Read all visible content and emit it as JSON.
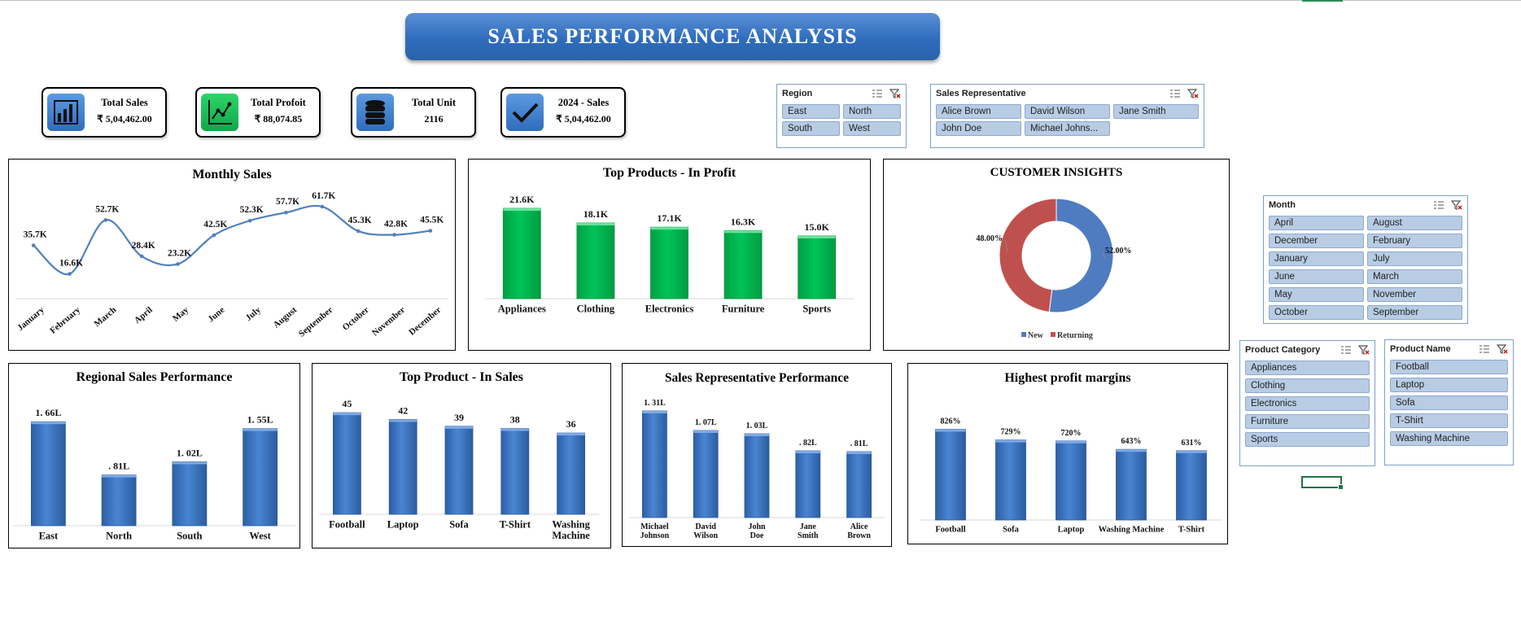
{
  "header": {
    "title": "SALES PERFORMANCE ANALYSIS"
  },
  "kpis": [
    {
      "label": "Total Sales",
      "value": "₹ 5,04,462.00",
      "icon": "bar-chart-icon",
      "color": "blue"
    },
    {
      "label": "Total Profoit",
      "value": "₹ 88,074.85",
      "icon": "line-chart-icon",
      "color": "green"
    },
    {
      "label": "Total Unit",
      "value": "2116",
      "icon": "database-icon",
      "color": "blue"
    },
    {
      "label": "2024 - Sales",
      "value": "₹ 5,04,462.00",
      "icon": "checkmark-icon",
      "color": "blue"
    }
  ],
  "colors": {
    "bar_blue": "#3a75c4",
    "bar_green": "#00b050",
    "donut_new": "#4f7cc0",
    "donut_returning": "#c0504d",
    "slicer_item": "#b8cce4"
  },
  "slicers": {
    "region": {
      "title": "Region",
      "items": [
        "East",
        "North",
        "South",
        "West"
      ]
    },
    "sales_rep": {
      "title": "Sales Representative",
      "items": [
        "Alice Brown",
        "David Wilson",
        "Jane Smith",
        "John Doe",
        "Michael Johns..."
      ]
    },
    "month": {
      "title": "Month",
      "items": [
        "April",
        "August",
        "December",
        "February",
        "January",
        "July",
        "June",
        "March",
        "May",
        "November",
        "October",
        "September"
      ]
    },
    "product_category": {
      "title": "Product Category",
      "items": [
        "Appliances",
        "Clothing",
        "Electronics",
        "Furniture",
        "Sports"
      ]
    },
    "product_name": {
      "title": "Product Name",
      "items": [
        "Football",
        "Laptop",
        "Sofa",
        "T-Shirt",
        "Washing Machine"
      ]
    }
  },
  "chart_data": [
    {
      "id": "monthly",
      "type": "line",
      "title": "Monthly Sales",
      "categories": [
        "January",
        "February",
        "March",
        "April",
        "May",
        "June",
        "July",
        "August",
        "September",
        "October",
        "November",
        "December"
      ],
      "values": [
        35.7,
        16.6,
        52.7,
        28.4,
        23.2,
        42.5,
        52.3,
        57.7,
        61.7,
        45.3,
        42.8,
        45.5
      ],
      "labels": [
        "35.7K",
        "16.6K",
        "52.7K",
        "28.4K",
        "23.2K",
        "42.5K",
        "52.3K",
        "57.7K",
        "61.7K",
        "45.3K",
        "42.8K",
        "45.5K"
      ],
      "smooth": true
    },
    {
      "id": "top_profit",
      "type": "bar",
      "title": "Top Products - In Profit",
      "categories": [
        "Appliances",
        "Clothing",
        "Electronics",
        "Furniture",
        "Sports"
      ],
      "values": [
        21.6,
        18.1,
        17.1,
        16.3,
        15.0
      ],
      "labels": [
        "21.6K",
        "18.1K",
        "17.1K",
        "16.3K",
        "15.0K"
      ],
      "color": "green"
    },
    {
      "id": "customer",
      "type": "pie",
      "title": "CUSTOMER INSIGHTS",
      "donut": true,
      "categories": [
        "New",
        "Returning"
      ],
      "values": [
        52.0,
        48.0
      ],
      "labels": [
        "52.00%",
        "48.00%"
      ],
      "legend": "bottom"
    },
    {
      "id": "regional",
      "type": "bar",
      "title": "Regional Sales Performance",
      "categories": [
        "East",
        "North",
        "South",
        "West"
      ],
      "values": [
        1.66,
        0.81,
        1.02,
        1.55
      ],
      "labels": [
        "1. 66L",
        ". 81L",
        "1. 02L",
        "1. 55L"
      ],
      "color": "blue"
    },
    {
      "id": "top_sales",
      "type": "bar",
      "title": "Top Product - In Sales",
      "categories": [
        "Football",
        "Laptop",
        "Sofa",
        "T-Shirt",
        "Washing Machine"
      ],
      "values": [
        45,
        42,
        39,
        38,
        36
      ],
      "labels": [
        "45",
        "42",
        "39",
        "38",
        "36"
      ],
      "color": "blue"
    },
    {
      "id": "rep_perf",
      "type": "bar",
      "title": "Sales Representative Performance",
      "categories": [
        "Michael Johnson",
        "David Wilson",
        "John Doe",
        "Jane Smith",
        "Alice Brown"
      ],
      "values": [
        1.31,
        1.07,
        1.03,
        0.82,
        0.81
      ],
      "labels": [
        "1. 31L",
        "1. 07L",
        "1. 03L",
        ". 82L",
        ". 81L"
      ],
      "color": "blue"
    },
    {
      "id": "margins",
      "type": "bar",
      "title": "Highest profit margins",
      "categories": [
        "Football",
        "Sofa",
        "Laptop",
        "Washing Machine",
        "T-Shirt"
      ],
      "values": [
        826,
        729,
        720,
        643,
        631
      ],
      "labels": [
        "826%",
        "729%",
        "720%",
        "643%",
        "631%"
      ],
      "color": "blue"
    }
  ]
}
